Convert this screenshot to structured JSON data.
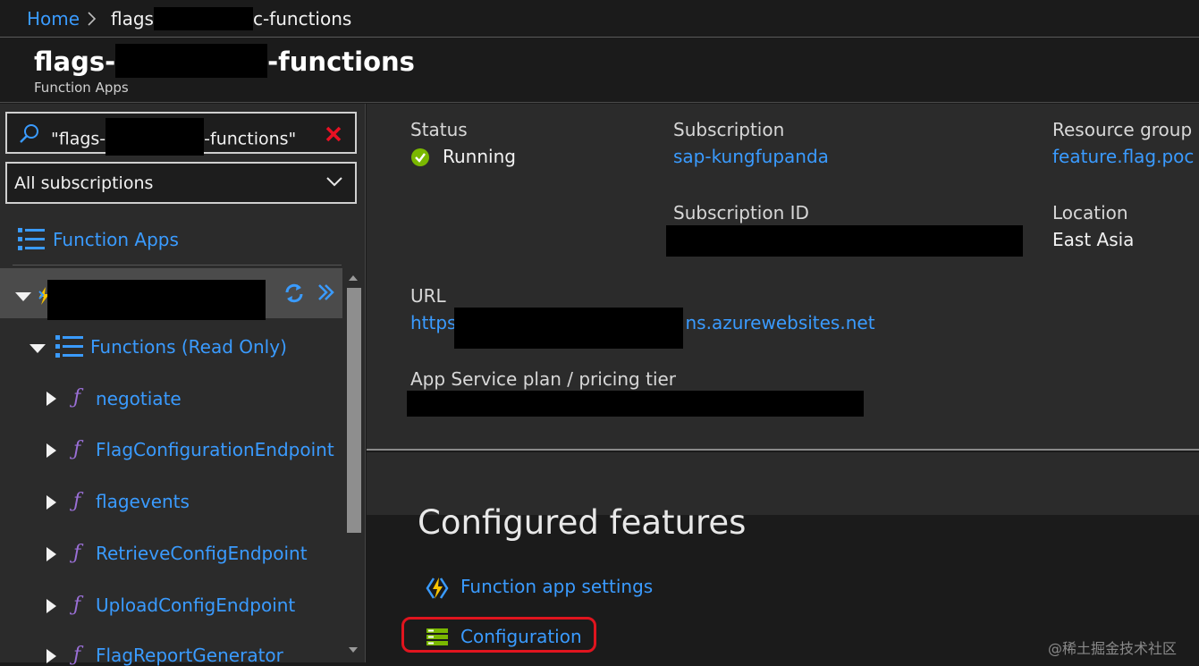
{
  "breadcrumb": {
    "home": "Home",
    "current": "flags-c-functions",
    "current_prefix": "flags",
    "current_suffix": "c-functions"
  },
  "header": {
    "title_prefix": "flags-",
    "title_suffix": "-functions",
    "subtitle": "Function Apps"
  },
  "sidebar": {
    "search_prefix": "\"flags-",
    "search_suffix": "-functions\"",
    "subscription_filter": "All subscriptions",
    "section_label": "Function Apps",
    "functions_group": "Functions (Read Only)",
    "functions": [
      "negotiate",
      "FlagConfigurationEndpoint",
      "flagevents",
      "RetrieveConfigEndpoint",
      "UploadConfigEndpoint",
      "FlagReportGenerator"
    ]
  },
  "essentials": {
    "status_label": "Status",
    "status_value": "Running",
    "subscription_label": "Subscription",
    "subscription_value": "sap-kungfupanda",
    "resource_group_label": "Resource group",
    "resource_group_value": "feature.flag.poc",
    "subscription_id_label": "Subscription ID",
    "location_label": "Location",
    "location_value": "East Asia",
    "url_label": "URL",
    "url_prefix": "https",
    "url_suffix": "ns.azurewebsites.net",
    "plan_label": "App Service plan / pricing tier"
  },
  "features": {
    "title": "Configured features",
    "items": [
      "Function app settings",
      "Configuration"
    ]
  },
  "watermark": "@稀土掘金技术社区",
  "colors": {
    "accent": "#3a9bff",
    "status_ok": "#7ab800",
    "highlight": "#e0141e",
    "function_glyph": "#9a6fd6"
  }
}
